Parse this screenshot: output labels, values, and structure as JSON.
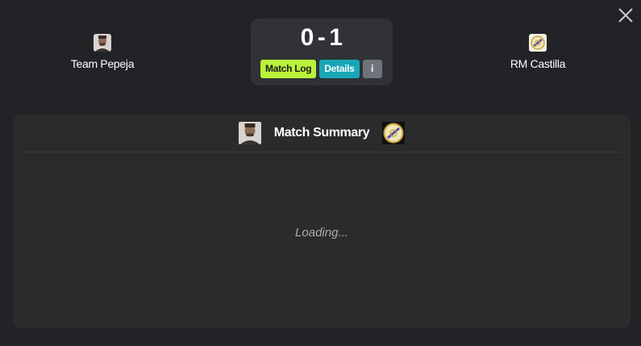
{
  "home_team": {
    "name": "Team Pepeja",
    "logo_icon": "player-portrait-icon"
  },
  "away_team": {
    "name": "RM Castilla",
    "logo_icon": "real-madrid-crest-icon"
  },
  "score": {
    "home": "0",
    "separator": "-",
    "away": "1"
  },
  "buttons": {
    "match_log": "Match Log",
    "details": "Details",
    "info": "i"
  },
  "summary": {
    "title": "Match Summary",
    "loading_text": "Loading..."
  },
  "colors": {
    "background": "#212326",
    "card": "#2b2b2b",
    "score_box": "#303236",
    "match_log": "#b9f23a",
    "details": "#19a6b8",
    "info": "#6d747c"
  },
  "close_icon": "close-icon"
}
